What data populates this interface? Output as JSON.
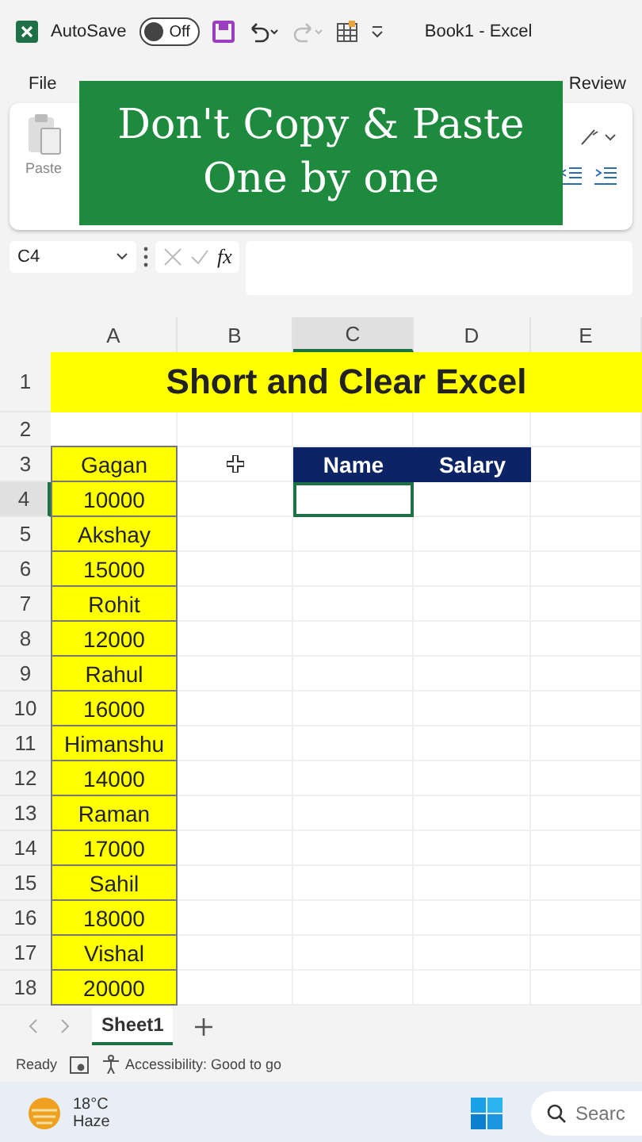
{
  "title_bar": {
    "autosave_label": "AutoSave",
    "autosave_toggle": {
      "label": "Off",
      "on": false
    },
    "title": "Book1  -  Excel"
  },
  "ribbon_tabs": [
    "File",
    "Review"
  ],
  "ribbon": {
    "paste_label": "Paste"
  },
  "formula_bar": {
    "name_box": "C4",
    "fx": "fx"
  },
  "overlay_caption": {
    "lines": [
      "Don't Copy & Paste",
      "One by one"
    ]
  },
  "sheet": {
    "columns": [
      {
        "label": "A",
        "selected": false
      },
      {
        "label": "B",
        "selected": false
      },
      {
        "label": "C",
        "selected": true
      },
      {
        "label": "D",
        "selected": false
      },
      {
        "label": "E",
        "selected": false
      }
    ],
    "title": "Short and Clear Excel",
    "table_headers": [
      "Name",
      "Salary"
    ],
    "rows": [
      {
        "number": "1",
        "selected": false
      },
      {
        "number": "2",
        "selected": false
      },
      {
        "number": "3",
        "selected": false,
        "a": "Gagan"
      },
      {
        "number": "4",
        "selected": true,
        "a": "10000"
      },
      {
        "number": "5",
        "selected": false,
        "a": "Akshay"
      },
      {
        "number": "6",
        "selected": false,
        "a": "15000"
      },
      {
        "number": "7",
        "selected": false,
        "a": "Rohit"
      },
      {
        "number": "8",
        "selected": false,
        "a": "12000"
      },
      {
        "number": "9",
        "selected": false,
        "a": "Rahul"
      },
      {
        "number": "10",
        "selected": false,
        "a": "16000"
      },
      {
        "number": "11",
        "selected": false,
        "a": "Himanshu"
      },
      {
        "number": "12",
        "selected": false,
        "a": "14000"
      },
      {
        "number": "13",
        "selected": false,
        "a": "Raman"
      },
      {
        "number": "14",
        "selected": false,
        "a": "17000"
      },
      {
        "number": "15",
        "selected": false,
        "a": "Sahil"
      },
      {
        "number": "16",
        "selected": false,
        "a": "18000"
      },
      {
        "number": "17",
        "selected": false,
        "a": "Vishal"
      },
      {
        "number": "18",
        "selected": false,
        "a": "20000"
      }
    ]
  },
  "sheet_tabs": [
    {
      "label": "Sheet1",
      "selected": true
    }
  ],
  "status_bar": {
    "ready": "Ready",
    "accessibility": "Accessibility: Good to go"
  },
  "taskbar": {
    "temperature": "18°C",
    "weather": "Haze",
    "search_placeholder": "Searc"
  }
}
